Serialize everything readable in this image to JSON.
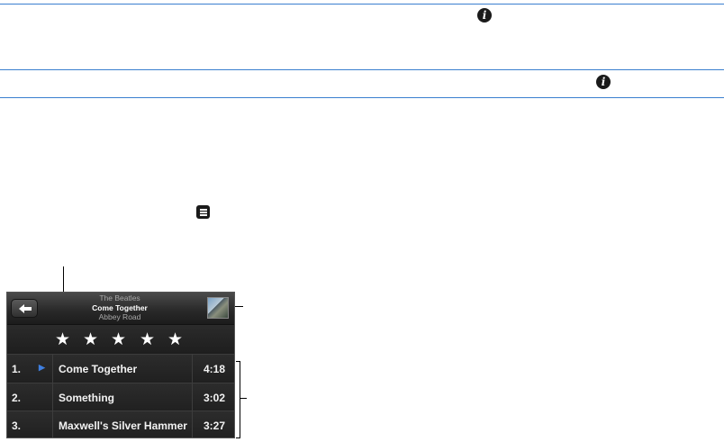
{
  "icons": {
    "info_glyph": "i",
    "star_glyph": "★",
    "play_glyph": "▶"
  },
  "colors": {
    "rule": "#3a7fcf",
    "play_indicator": "#3f7fe0"
  },
  "now_playing": {
    "artist": "The Beatles",
    "song": "Come Together",
    "album": "Abbey Road"
  },
  "rating": {
    "stars": 5
  },
  "tracks": [
    {
      "number": "1.",
      "title": "Come Together",
      "duration": "4:18",
      "playing": true
    },
    {
      "number": "2.",
      "title": "Something",
      "duration": "3:02",
      "playing": false
    },
    {
      "number": "3.",
      "title": "Maxwell's Silver Hammer",
      "duration": "3:27",
      "playing": false
    }
  ]
}
